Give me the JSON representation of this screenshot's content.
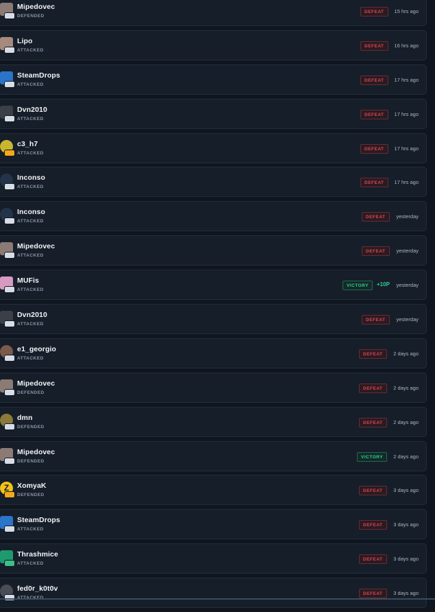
{
  "matches": [
    {
      "name": "Mipedovec",
      "role": "DEFENDED",
      "result": "DEFEAT",
      "points": "",
      "time": "15 hrs ago",
      "avatar_color": "#8b7b74",
      "avatar_icon": "face-avatar-icon",
      "level_style": "silver"
    },
    {
      "name": "Lipo",
      "role": "ATTACKED",
      "result": "DEFEAT",
      "points": "",
      "time": "16 hrs ago",
      "avatar_color": "#a68a7d",
      "avatar_icon": "face-avatar-icon",
      "level_style": "silver"
    },
    {
      "name": "SteamDrops",
      "role": "ATTACKED",
      "result": "DEFEAT",
      "points": "",
      "time": "17 hrs ago",
      "avatar_color": "#2a74c9",
      "avatar_icon": "drop-avatar-icon",
      "level_style": "silver"
    },
    {
      "name": "Dvn2010",
      "role": "ATTACKED",
      "result": "DEFEAT",
      "points": "",
      "time": "17 hrs ago",
      "avatar_color": "#3b3f46",
      "avatar_icon": "dark-avatar-icon",
      "level_style": "silver"
    },
    {
      "name": "c3_h7",
      "role": "ATTACKED",
      "result": "DEFEAT",
      "points": "",
      "time": "17 hrs ago",
      "avatar_color": "#c9b630",
      "avatar_icon": "yellow-avatar-icon",
      "level_style": "gold"
    },
    {
      "name": "Inconso",
      "role": "ATTACKED",
      "result": "DEFEAT",
      "points": "",
      "time": "17 hrs ago",
      "avatar_color": "#233449",
      "avatar_icon": "round-dark-avatar-icon",
      "level_style": "silver"
    },
    {
      "name": "Inconso",
      "role": "ATTACKED",
      "result": "DEFEAT",
      "points": "",
      "time": "yesterday",
      "avatar_color": "#233449",
      "avatar_icon": "round-dark-avatar-icon",
      "level_style": "silver"
    },
    {
      "name": "Mipedovec",
      "role": "ATTACKED",
      "result": "DEFEAT",
      "points": "",
      "time": "yesterday",
      "avatar_color": "#8b7b74",
      "avatar_icon": "face-avatar-icon",
      "level_style": "silver"
    },
    {
      "name": "MUFis",
      "role": "ATTACKED",
      "result": "VICTORY",
      "points": "+10P",
      "time": "yesterday",
      "avatar_color": "#d89ac0",
      "avatar_icon": "pink-avatar-icon",
      "level_style": "silver"
    },
    {
      "name": "Dvn2010",
      "role": "ATTACKED",
      "result": "DEFEAT",
      "points": "",
      "time": "yesterday",
      "avatar_color": "#3b3f46",
      "avatar_icon": "dark-avatar-icon",
      "level_style": "silver"
    },
    {
      "name": "e1_georgio",
      "role": "ATTACKED",
      "result": "DEFEAT",
      "points": "",
      "time": "2 days ago",
      "avatar_color": "#7a5a4a",
      "avatar_icon": "round-face-avatar-icon",
      "level_style": "silver"
    },
    {
      "name": "Mipedovec",
      "role": "DEFENDED",
      "result": "DEFEAT",
      "points": "",
      "time": "2 days ago",
      "avatar_color": "#8b7b74",
      "avatar_icon": "face-avatar-icon",
      "level_style": "silver"
    },
    {
      "name": "dmn",
      "role": "DEFENDED",
      "result": "DEFEAT",
      "points": "",
      "time": "2 days ago",
      "avatar_color": "#8a7a3a",
      "avatar_icon": "round-olive-avatar-icon",
      "level_style": "silver"
    },
    {
      "name": "Mipedovec",
      "role": "DEFENDED",
      "result": "VICTORY",
      "points": "",
      "time": "2 days ago",
      "avatar_color": "#8b7b74",
      "avatar_icon": "face-avatar-icon",
      "level_style": "silver"
    },
    {
      "name": "XomyaK",
      "role": "DEFENDED",
      "result": "DEFEAT",
      "points": "",
      "time": "3 days ago",
      "avatar_color": "#f2c21b",
      "avatar_icon": "z-logo-avatar-icon",
      "level_style": "gold"
    },
    {
      "name": "SteamDrops",
      "role": "ATTACKED",
      "result": "DEFEAT",
      "points": "",
      "time": "3 days ago",
      "avatar_color": "#2a74c9",
      "avatar_icon": "drop-avatar-icon",
      "level_style": "silver"
    },
    {
      "name": "Thrashmice",
      "role": "ATTACKED",
      "result": "DEFEAT",
      "points": "",
      "time": "3 days ago",
      "avatar_color": "#1f9a6e",
      "avatar_icon": "github-avatar-icon",
      "level_style": "green"
    },
    {
      "name": "fed0r_k0t0v",
      "role": "ATTACKED",
      "result": "DEFEAT",
      "points": "",
      "time": "3 days ago",
      "avatar_color": "#4a4d55",
      "avatar_icon": "round-face-avatar-icon",
      "level_style": "silver"
    }
  ]
}
